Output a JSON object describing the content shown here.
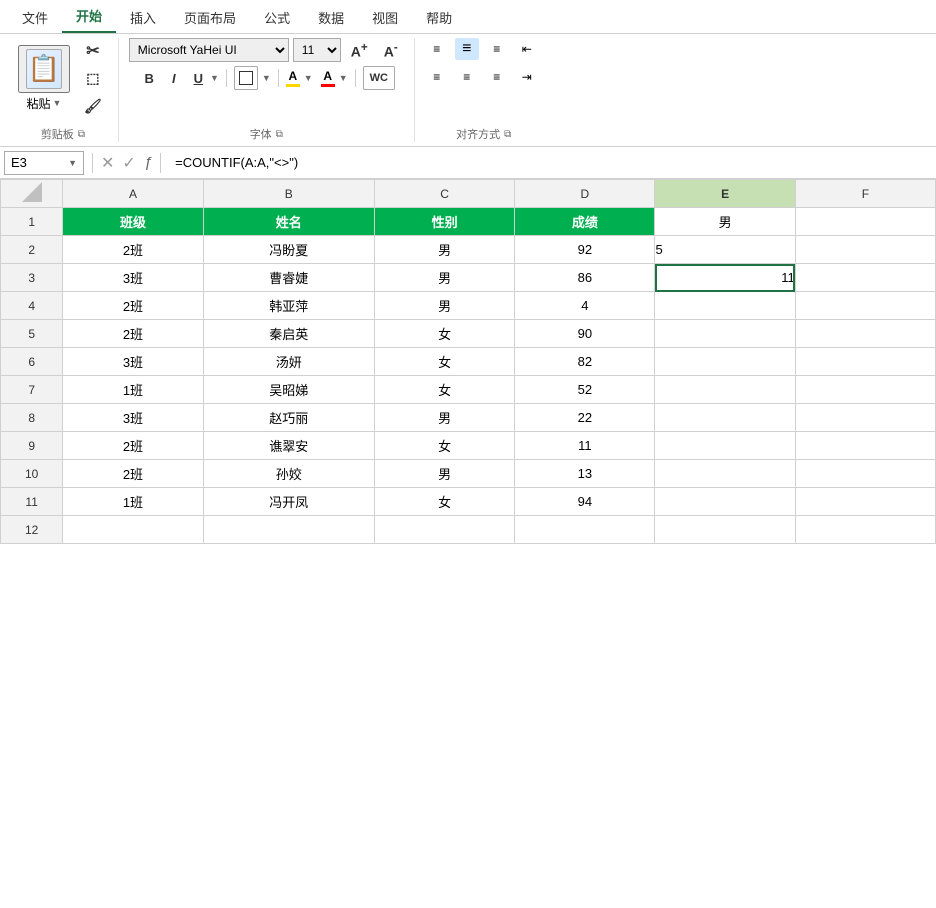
{
  "ribbon": {
    "tabs": [
      "文件",
      "开始",
      "插入",
      "页面布局",
      "公式",
      "数据",
      "视图",
      "帮助"
    ],
    "active_tab": "开始",
    "groups": {
      "clipboard": {
        "label": "剪贴板",
        "paste_label": "粘贴"
      },
      "font": {
        "label": "字体",
        "font_name": "Microsoft YaHei UI",
        "font_size": "11",
        "bold": "B",
        "italic": "I",
        "underline": "U"
      },
      "alignment": {
        "label": "对齐方式"
      }
    }
  },
  "formula_bar": {
    "cell_ref": "E3",
    "formula": "=COUNTIF(A:A,\"<>\")"
  },
  "columns": [
    "A",
    "B",
    "C",
    "D",
    "E",
    "F"
  ],
  "headers": {
    "row_nums": [
      1,
      2,
      3,
      4,
      5,
      6,
      7,
      8,
      9,
      10,
      11,
      12
    ]
  },
  "col_headers_labels": {
    "A": "班级",
    "B": "姓名",
    "C": "性别",
    "D": "成绩"
  },
  "rows": [
    {
      "row": 1,
      "A": "班级",
      "B": "姓名",
      "C": "性别",
      "D": "成绩",
      "E": "男",
      "F": "",
      "header": true
    },
    {
      "row": 2,
      "A": "2班",
      "B": "冯盼夏",
      "C": "男",
      "D": "92",
      "E": "5",
      "F": ""
    },
    {
      "row": 3,
      "A": "3班",
      "B": "曹睿婕",
      "C": "男",
      "D": "86",
      "E": "11",
      "F": "",
      "active_e": true
    },
    {
      "row": 4,
      "A": "2班",
      "B": "韩亚萍",
      "C": "男",
      "D": "4",
      "E": "",
      "F": ""
    },
    {
      "row": 5,
      "A": "2班",
      "B": "秦启英",
      "C": "女",
      "D": "90",
      "E": "",
      "F": ""
    },
    {
      "row": 6,
      "A": "3班",
      "B": "汤妍",
      "C": "女",
      "D": "82",
      "E": "",
      "F": ""
    },
    {
      "row": 7,
      "A": "1班",
      "B": "吴昭娣",
      "C": "女",
      "D": "52",
      "E": "",
      "F": ""
    },
    {
      "row": 8,
      "A": "3班",
      "B": "赵巧丽",
      "C": "男",
      "D": "22",
      "E": "",
      "F": ""
    },
    {
      "row": 9,
      "A": "2班",
      "B": "谯翠安",
      "C": "女",
      "D": "11",
      "E": "",
      "F": ""
    },
    {
      "row": 10,
      "A": "2班",
      "B": "孙姣",
      "C": "男",
      "D": "13",
      "E": "",
      "F": ""
    },
    {
      "row": 11,
      "A": "1班",
      "B": "冯开凤",
      "C": "女",
      "D": "94",
      "E": "",
      "F": ""
    },
    {
      "row": 12,
      "A": "",
      "B": "",
      "C": "",
      "D": "",
      "E": "",
      "F": ""
    }
  ]
}
